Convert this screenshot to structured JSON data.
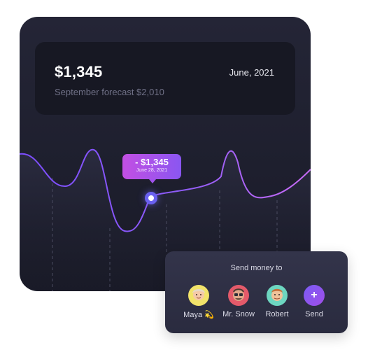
{
  "summary": {
    "amount": "$1,345",
    "date": "June, 2021",
    "forecast": "September forecast $2,010"
  },
  "tooltip": {
    "amount": "- $1,345",
    "date": "June 28, 2021"
  },
  "colors": {
    "line_start": "#7c4dff",
    "line_end": "#c86bf5",
    "tooltip": "#a052ec",
    "marker": "#6a61f0",
    "send_button": "#8a56f1"
  },
  "send_panel": {
    "title": "Send money to",
    "contacts": [
      {
        "name": "Maya 💫",
        "avatar_icon": "memoji-avatar-icon",
        "color": "#f2e36a"
      },
      {
        "name": "Mr. Snow",
        "avatar_icon": "memoji-avatar-icon",
        "color": "#e45a6a"
      },
      {
        "name": "Robert",
        "avatar_icon": "memoji-avatar-icon",
        "color": "#6dd6c0"
      }
    ],
    "send": {
      "label": "Send",
      "icon": "plus-icon",
      "glyph": "+"
    }
  }
}
